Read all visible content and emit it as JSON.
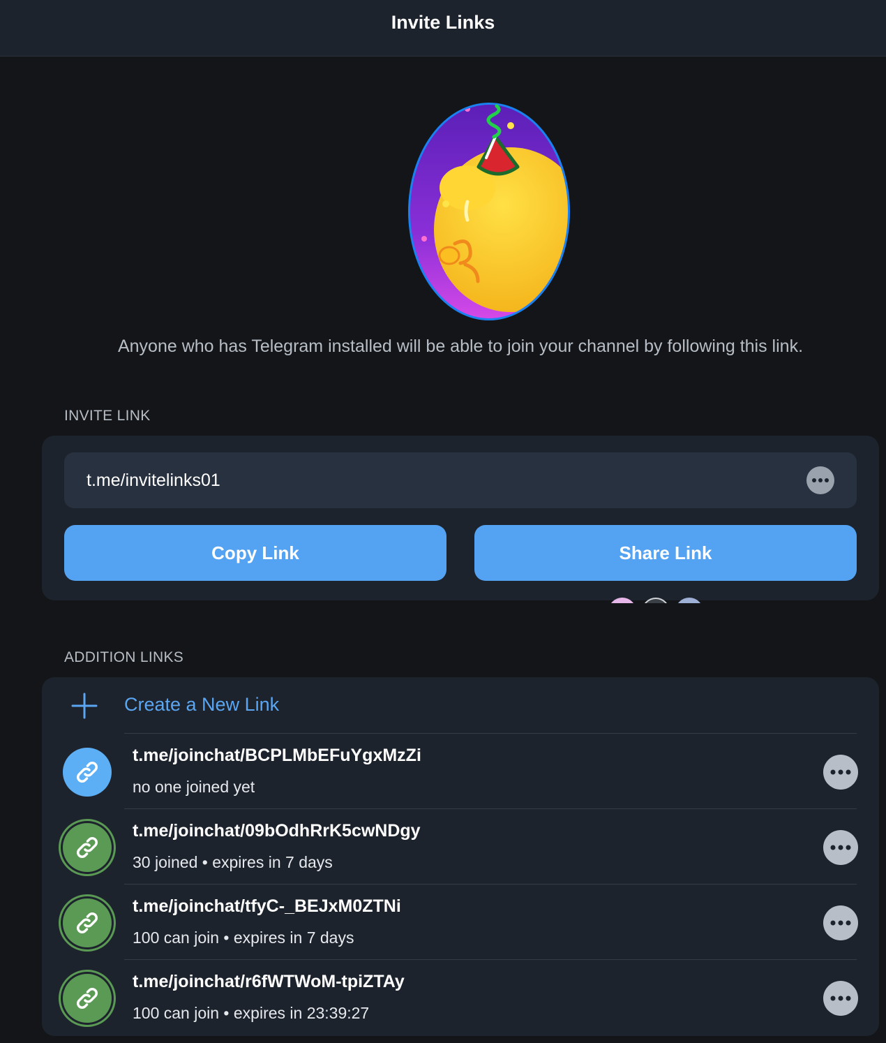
{
  "header": {
    "title": "Invite Links"
  },
  "description": "Anyone who has Telegram installed will be able to join your channel by following this link.",
  "invite_link": {
    "section_label": "INVITE LINK",
    "url": "t.me/invitelinks01",
    "copy_label": "Copy Link",
    "share_label": "Share Link"
  },
  "addition_links": {
    "section_label": "ADDITION LINKS",
    "create_label": "Create a New Link",
    "items": [
      {
        "url": "t.me/joinchat/BCPLMbEFuYgxMzZi",
        "status": "no one joined yet",
        "icon_color": "blue"
      },
      {
        "url": "t.me/joinchat/09bOdhRrK5cwNDgy",
        "status": "30 joined • expires in 7 days",
        "icon_color": "green"
      },
      {
        "url": "t.me/joinchat/tfyC-_BEJxM0ZTNi",
        "status": "100 can join • expires in 7 days",
        "icon_color": "green"
      },
      {
        "url": "t.me/joinchat/r6fWTWoM-tpiZTAy",
        "status": "100 can join • expires in 23:39:27",
        "icon_color": "green"
      }
    ]
  },
  "colors": {
    "background": "#141518",
    "card": "#1d232c",
    "accent": "#54a2f2",
    "link_blue": "#5caef5",
    "link_green": "#5a9a54"
  }
}
